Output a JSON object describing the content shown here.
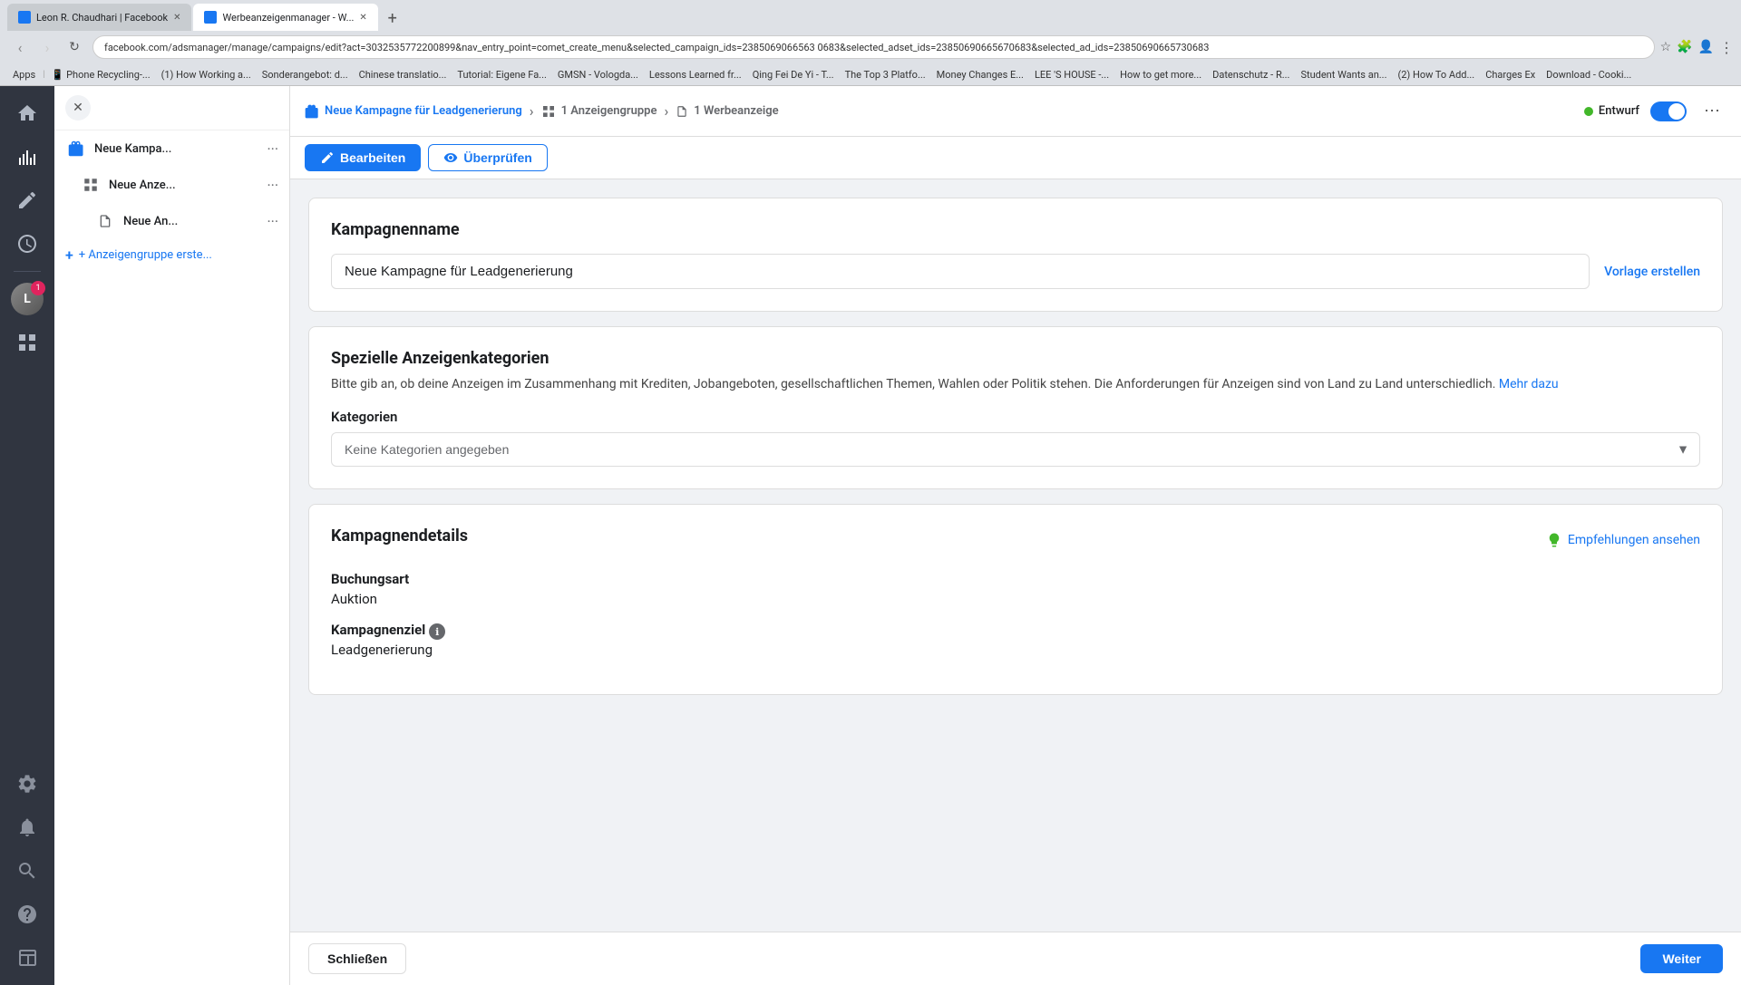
{
  "browser": {
    "tabs": [
      {
        "id": "tab1",
        "title": "Leon R. Chaudhari | Facebook",
        "favicon_color": "#1877f2",
        "active": false
      },
      {
        "id": "tab2",
        "title": "Werbeanzeigenmanager - W...",
        "favicon_color": "#1877f2",
        "active": true
      }
    ],
    "url": "facebook.com/adsmanager/manage/campaigns/edit?act=3032535772200899&nav_entry_point=comet_create_menu&selected_campaign_ids=2385069066563 0683&selected_adset_ids=23850690665670683&selected_ad_ids=23850690665730683",
    "bookmarks": [
      "Apps",
      "Phone Recycling-...",
      "(1) How Working a...",
      "Sonderangebot: d...",
      "Chinese translatio...",
      "Tutorial: Eigene Fa...",
      "GMSN - Vologda...",
      "Lessons Learned fr...",
      "Qing Fei De Yi - T...",
      "The Top 3 Platfo...",
      "Money Changes E...",
      "LEE 'S HOUSE -...",
      "How to get more...",
      "Datenschutz - R...",
      "Student Wants an...",
      "(2) How To Add...",
      "Download - Cooki..."
    ]
  },
  "sidebar_icons": {
    "home": "🏠",
    "chart": "📊",
    "edit": "✏️",
    "clock": "🕐",
    "avatar_badge": "1",
    "grid": "▦",
    "settings": "⚙️",
    "bell": "🔔",
    "search": "🔍",
    "question": "❓",
    "table": "⊞"
  },
  "campaign_sidebar": {
    "close_label": "✕",
    "items": [
      {
        "type": "campaign",
        "icon": "📁",
        "label": "Neue Kampa..."
      },
      {
        "type": "adset",
        "icon": "⊞",
        "label": "Neue Anze..."
      },
      {
        "type": "ad",
        "icon": "📄",
        "label": "Neue An..."
      }
    ],
    "add_label": "+ Anzeigengruppe erste..."
  },
  "breadcrumb": {
    "campaign": "Neue Kampagne für Leadgenerierung",
    "adset": "1 Anzeigengruppe",
    "ad": "1 Werbeanzeige"
  },
  "top_nav": {
    "status_label": "Entwurf",
    "more_icon": "⋯"
  },
  "action_buttons": {
    "edit_label": "Bearbeiten",
    "review_label": "Überprüfen"
  },
  "form": {
    "campaign_name_section": {
      "title": "Kampagnenname",
      "input_value": "Neue Kampagne für Leadgenerierung",
      "template_link": "Vorlage erstellen"
    },
    "special_categories_section": {
      "title": "Spezielle Anzeigenkategorien",
      "description": "Bitte gib an, ob deine Anzeigen im Zusammenhang mit Krediten, Jobangeboten, gesellschaftlichen Themen, Wahlen oder Politik stehen. Die Anforderungen für Anzeigen sind von Land zu Land unterschiedlich.",
      "mehr_link": "Mehr dazu",
      "kategorien_label": "Kategorien",
      "select_placeholder": "Keine Kategorien angegeben"
    },
    "kampagnen_details_section": {
      "title": "Kampagnendetails",
      "empfehlungen_label": "Empfehlungen ansehen",
      "buchungsart_label": "Buchungsart",
      "buchungsart_value": "Auktion",
      "kampagnenziel_label": "Kampagnenziel",
      "kampagnenziel_value": "Leadgenerierung"
    }
  },
  "bottom_bar": {
    "close_label": "Schließen",
    "next_label": "Weiter"
  },
  "colors": {
    "primary_blue": "#1877f2",
    "sidebar_bg": "#303540",
    "card_bg": "#ffffff",
    "bg": "#f0f2f5"
  }
}
